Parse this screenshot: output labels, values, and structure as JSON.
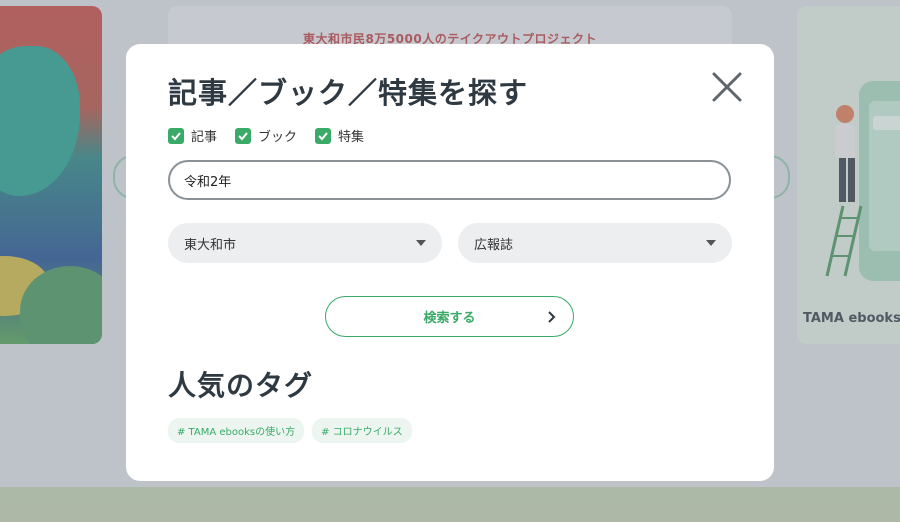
{
  "background": {
    "banner_text": "東大和市民8万5000人のテイクアウトプロジェクト",
    "right_card_caption": "TAMA ebooks:"
  },
  "modal": {
    "title": "記事／ブック／特集を探す",
    "close_icon": "close-icon",
    "checkboxes": [
      {
        "label": "記事",
        "checked": true
      },
      {
        "label": "ブック",
        "checked": true
      },
      {
        "label": "特集",
        "checked": true
      }
    ],
    "search": {
      "value": "令和2年",
      "placeholder": ""
    },
    "selects": {
      "area": "東大和市",
      "type": "広報誌"
    },
    "submit_label": "検索する",
    "tags_title": "人気のタグ",
    "tags": [
      "# TAMA ebooksの使い方",
      "# コロナウイルス"
    ]
  },
  "colors": {
    "accent": "#3aaa68",
    "heading": "#2f3942",
    "banner": "#b43a3a"
  }
}
